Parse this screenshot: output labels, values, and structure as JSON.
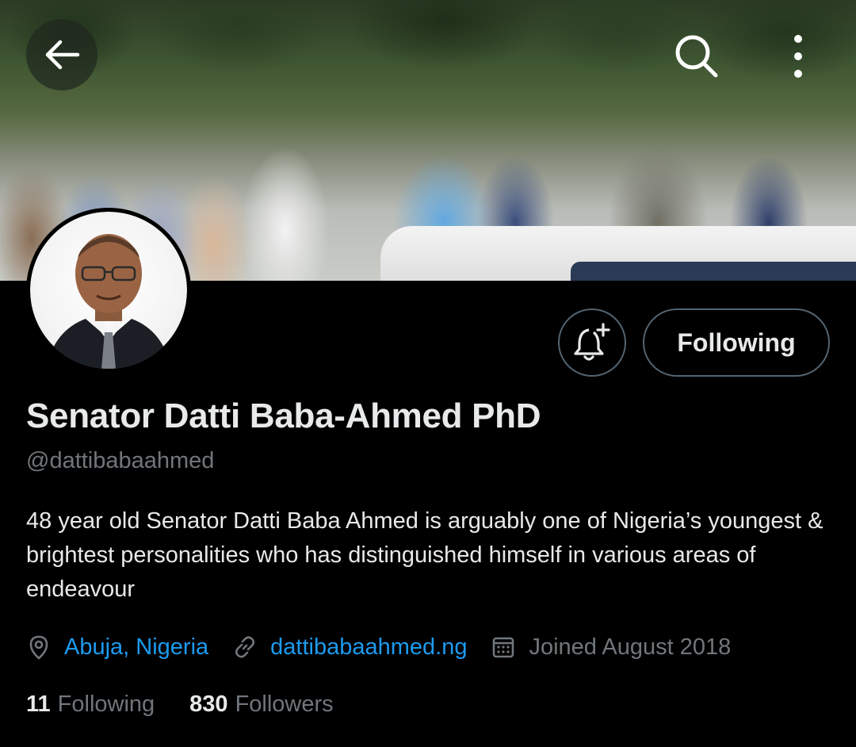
{
  "header": {
    "back_icon": "arrow-left-icon",
    "search_icon": "search-icon",
    "more_icon": "more-vertical-icon"
  },
  "profile": {
    "display_name": "Senator Datti Baba-Ahmed PhD",
    "handle": "@dattibabaahmed",
    "bio": "48 year old Senator Datti Baba Ahmed is arguably one of Nigeria’s youngest & brightest personalities who has distinguished himself in various areas of endeavour",
    "location": "Abuja, Nigeria",
    "website": "dattibabaahmed.ng",
    "joined": "Joined August 2018",
    "following_count": "11",
    "following_label": "Following",
    "followers_count": "830",
    "followers_label": "Followers"
  },
  "actions": {
    "notify_icon": "bell-plus-icon",
    "following_button": "Following"
  },
  "colors": {
    "background": "#000000",
    "text_primary": "#e7e9ea",
    "text_secondary": "#71767b",
    "link": "#1d9bf0",
    "border": "#536471"
  }
}
